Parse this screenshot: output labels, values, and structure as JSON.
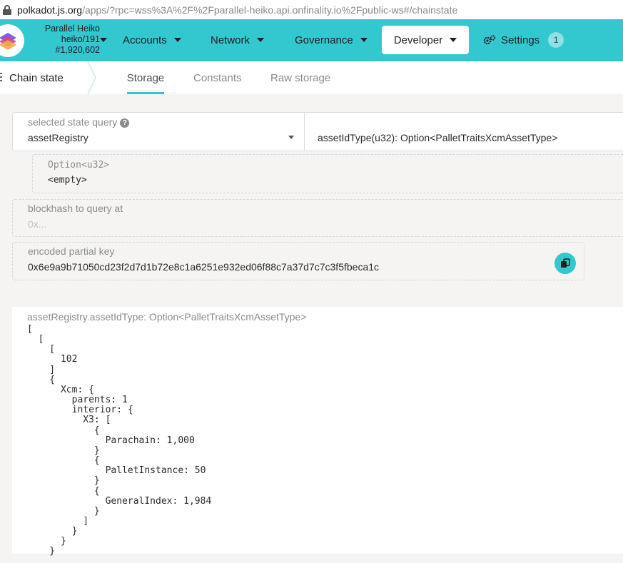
{
  "browser": {
    "url_host": "polkadot.js.org",
    "url_path": "/apps/?rpc=wss%3A%2F%2Fparallel-heiko.api.onfinality.io%2Fpublic-ws#/chainstate"
  },
  "chain": {
    "name": "Parallel Heiko",
    "spec": "heiko/191",
    "block": "#1,920,602"
  },
  "nav": {
    "accounts": "Accounts",
    "network": "Network",
    "governance": "Governance",
    "developer": "Developer",
    "settings": "Settings",
    "settings_badge": "1"
  },
  "subnav": {
    "section": "Chain state",
    "tabs": [
      "Storage",
      "Constants",
      "Raw storage"
    ]
  },
  "query": {
    "label": "selected state query",
    "module": "assetRegistry",
    "method": "assetIdType(u32): Option<PalletTraitsXcmAssetType>"
  },
  "param": {
    "type": "Option<u32>",
    "value": "<empty>"
  },
  "blockhash": {
    "label": "blockhash to query at",
    "placeholder": "0x..."
  },
  "encoded": {
    "label": "encoded partial key",
    "value": "0x6e9a9b71050cd23f2d7d1b72e8c1a6251e932ed06f88c7a37d7c7c3f5fbeca1c"
  },
  "result": {
    "label": "assetRegistry.assetIdType: Option<PalletTraitsXcmAssetType>",
    "output": "[\n  [\n    [\n      102\n    ]\n    {\n      Xcm: {\n        parents: 1\n        interior: {\n          X3: [\n            {\n              Parachain: 1,000\n            }\n            {\n              PalletInstance: 50\n            }\n            {\n              GeneralIndex: 1,984\n            }\n          ]\n        }\n      }\n    }"
  },
  "colors": {
    "accent": "#33c7cf",
    "background": "#f5f4f3"
  },
  "icons": {
    "lock": "lock-icon",
    "chain_logo": "parallel-logo-icon",
    "settings": "gear-icon",
    "copy": "copy-icon",
    "help": "help-icon"
  }
}
